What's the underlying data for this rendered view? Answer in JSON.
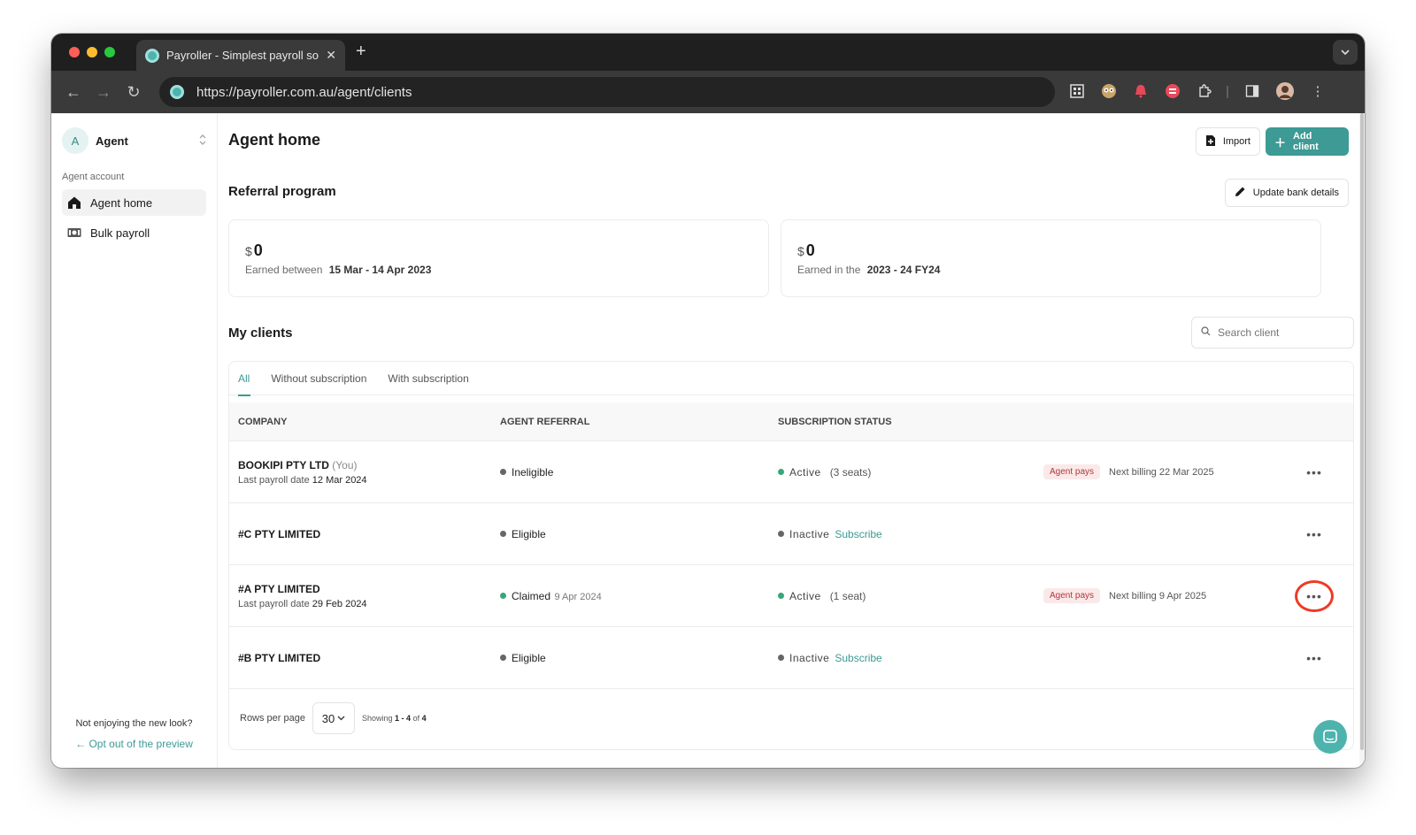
{
  "browser": {
    "tab_title": "Payroller - Simplest payroll so",
    "tab_close": "✕",
    "new_tab": "+",
    "url": "https://payroller.com.au/agent/clients"
  },
  "sidebar": {
    "avatar_letter": "A",
    "agent_name": "Agent",
    "section_label": "Agent account",
    "items": [
      {
        "label": "Agent home",
        "icon": "home-icon"
      },
      {
        "label": "Bulk payroll",
        "icon": "cash-icon"
      }
    ],
    "footer_question": "Not enjoying the new look?",
    "footer_link": "Opt out of the preview"
  },
  "header": {
    "title": "Agent home",
    "import_label": "Import",
    "add_client_label": "Add client"
  },
  "referral": {
    "title": "Referral program",
    "update_bank_label": "Update bank details",
    "cards": [
      {
        "currency": "$",
        "amount": "0",
        "prefix": "Earned between",
        "period": "15 Mar - 14 Apr  2023"
      },
      {
        "currency": "$",
        "amount": "0",
        "prefix": "Earned in the",
        "period": "2023 - 24  FY24"
      }
    ]
  },
  "clients": {
    "title": "My clients",
    "search_placeholder": "Search client",
    "tabs": [
      "All",
      "Without subscription",
      "With subscription"
    ],
    "columns": [
      "COMPANY",
      "AGENT REFERRAL",
      "SUBSCRIPTION STATUS"
    ],
    "rows": [
      {
        "company": "BOOKIPI PTY LTD",
        "you": "(You)",
        "last_label": "Last payroll date",
        "last_date": "12 Mar 2024",
        "referral": "Ineligible",
        "referral_date": "",
        "status": "Active",
        "seats": "(3 seats)",
        "subscribe": "",
        "badge": "Agent pays",
        "billing": "Next billing 22 Mar 2025"
      },
      {
        "company": "#C PTY LIMITED",
        "you": "",
        "last_label": "",
        "last_date": "",
        "referral": "Eligible",
        "referral_date": "",
        "status": "Inactive",
        "seats": "",
        "subscribe": "Subscribe",
        "badge": "",
        "billing": ""
      },
      {
        "company": "#A PTY LIMITED",
        "you": "",
        "last_label": "Last payroll date",
        "last_date": "29 Feb 2024",
        "referral": "Claimed",
        "referral_date": "9 Apr 2024",
        "status": "Active",
        "seats": "(1 seat)",
        "subscribe": "",
        "badge": "Agent pays",
        "billing": "Next billing 9 Apr 2025"
      },
      {
        "company": "#B PTY LIMITED",
        "you": "",
        "last_label": "",
        "last_date": "",
        "referral": "Eligible",
        "referral_date": "",
        "status": "Inactive",
        "seats": "",
        "subscribe": "Subscribe",
        "badge": "",
        "billing": ""
      }
    ],
    "more_label": "•••",
    "rows_per_page_label": "Rows per page",
    "rows_per_page_value": "30",
    "showing_prefix": "Showing",
    "showing_range": "1 - 4",
    "showing_of": "of",
    "showing_total": "4"
  },
  "colors": {
    "accent": "#3d9a94",
    "highlight_ring": "#ee3a24",
    "active_dot": "#3aa57a",
    "badge_text": "#b3363a"
  }
}
